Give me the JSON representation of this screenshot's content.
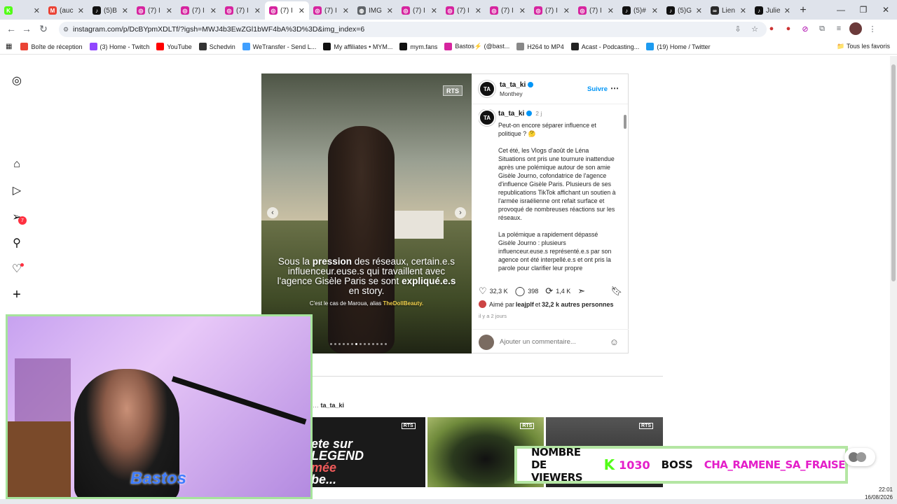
{
  "browser": {
    "tabs": [
      {
        "label": "",
        "color": "#53fc18",
        "glyph": "K"
      },
      {
        "label": "(auc",
        "color": "#ea4335",
        "glyph": "M"
      },
      {
        "label": "(5)B",
        "color": "#111111",
        "glyph": "♪"
      },
      {
        "label": "(7) I",
        "color": "#d6249f",
        "glyph": "◎"
      },
      {
        "label": "(7) I",
        "color": "#d6249f",
        "glyph": "◎"
      },
      {
        "label": "(7) I",
        "color": "#d6249f",
        "glyph": "◎"
      },
      {
        "label": "(7) I",
        "color": "#d6249f",
        "glyph": "◎",
        "active": true
      },
      {
        "label": "(7) I",
        "color": "#d6249f",
        "glyph": "◎"
      },
      {
        "label": "IMG",
        "color": "#5f6368",
        "glyph": "◍"
      },
      {
        "label": "(7) I",
        "color": "#d6249f",
        "glyph": "◎"
      },
      {
        "label": "(7) I",
        "color": "#d6249f",
        "glyph": "◎"
      },
      {
        "label": "(7) I",
        "color": "#d6249f",
        "glyph": "◎"
      },
      {
        "label": "(7) I",
        "color": "#d6249f",
        "glyph": "◎"
      },
      {
        "label": "(7) I",
        "color": "#d6249f",
        "glyph": "◎"
      },
      {
        "label": "(5)#",
        "color": "#111111",
        "glyph": "♪"
      },
      {
        "label": "(5)G",
        "color": "#111111",
        "glyph": "♪"
      },
      {
        "label": "Lien",
        "color": "#2a2a2a",
        "glyph": "∞"
      },
      {
        "label": "Julie",
        "color": "#111111",
        "glyph": "♪"
      }
    ],
    "url": "instagram.com/p/DcBYpmXDLTf/?igsh=MWJ4b3EwZGl1bWF4bA%3D%3D&img_index=6",
    "bookmarks": [
      {
        "label": "Boîte de réception",
        "color": "#ea4335"
      },
      {
        "label": "(3) Home - Twitch",
        "color": "#9146ff"
      },
      {
        "label": "YouTube",
        "color": "#ff0000"
      },
      {
        "label": "Schedvin",
        "color": "#333333"
      },
      {
        "label": "WeTransfer - Send L...",
        "color": "#409fff"
      },
      {
        "label": "My affiliates • MYM...",
        "color": "#111111"
      },
      {
        "label": "mym.fans",
        "color": "#111111"
      },
      {
        "label": "Bastos⚡ (@bast...",
        "color": "#d6249f"
      },
      {
        "label": "H264 to MP4",
        "color": "#888888"
      },
      {
        "label": "Acast - Podcasting...",
        "color": "#222222"
      },
      {
        "label": "(19) Home / Twitter",
        "color": "#1d9bf0"
      }
    ],
    "all_bookmarks": "Tous les favoris"
  },
  "sidebar": {
    "notifications_badge": "7"
  },
  "post": {
    "image": {
      "watermark": "RTS",
      "caption_html_parts": [
        "Sous la ",
        "pression",
        " des réseaux, certain.e.s influenceur.euse.s qui travaillent avec l'agence Gisèle Paris se sont ",
        "expliqué.e.s",
        " en story."
      ],
      "subcaption": "C'est le cas de Maroua, alias ",
      "subcaption_bold": "TheDollBeauty.",
      "slide_count": 14,
      "active_slide": 6
    },
    "author": {
      "username": "ta_ta_ki",
      "location": "Monthey",
      "avatar_text": "TA",
      "follow_label": "Suivre"
    },
    "caption": {
      "username": "ta_ta_ki",
      "time": "2 j",
      "text": "Peut-on encore séparer influence et politique ? 🤔\n\nCet été, les Vlogs d'août de Léna Situations ont pris une tournure inattendue après une polémique autour de son amie Gisèle Journo, cofondatrice de l'agence d'influence Gisèle Paris. Plusieurs de ses republications TikTok affichant un soutien à l'armée israélienne ont refait surface et provoqué de nombreuses réactions sur les réseaux.\n\nLa polémique a rapidement dépassé Gisèle Journo : plusieurs influenceur.euse.s représenté.e.s par son agence ont été interpellé.e.s et ont pris la parole pour clarifier leur propre"
    },
    "stats": {
      "likes": "32,3 K",
      "comments": "398",
      "reposts": "1,4 K"
    },
    "liked_by": {
      "prefix": "Aimé par ",
      "user": "leajplf",
      "middle": " et ",
      "others": "32,2 k autres personnes"
    },
    "posted_ago": "il y a 2 jours",
    "comment_placeholder": "Ajouter un commentaire..."
  },
  "more_from": {
    "label": "ta_ta_ki",
    "thumb1_text": [
      "ete sur",
      "LEGEND",
      "mée",
      "be..."
    ],
    "watermark": "RTS"
  },
  "overlay": {
    "viewers_label": "NOMBRE DE VIEWERS",
    "kick_glyph": "K",
    "viewers_count": "1030",
    "boss_label": "BOSS",
    "boss_name": "CHA_RAMENE_SA_FRAISE",
    "webcam_logo": "Bastos"
  },
  "clock": {
    "time": "22:01",
    "date": "16/08/2026"
  }
}
